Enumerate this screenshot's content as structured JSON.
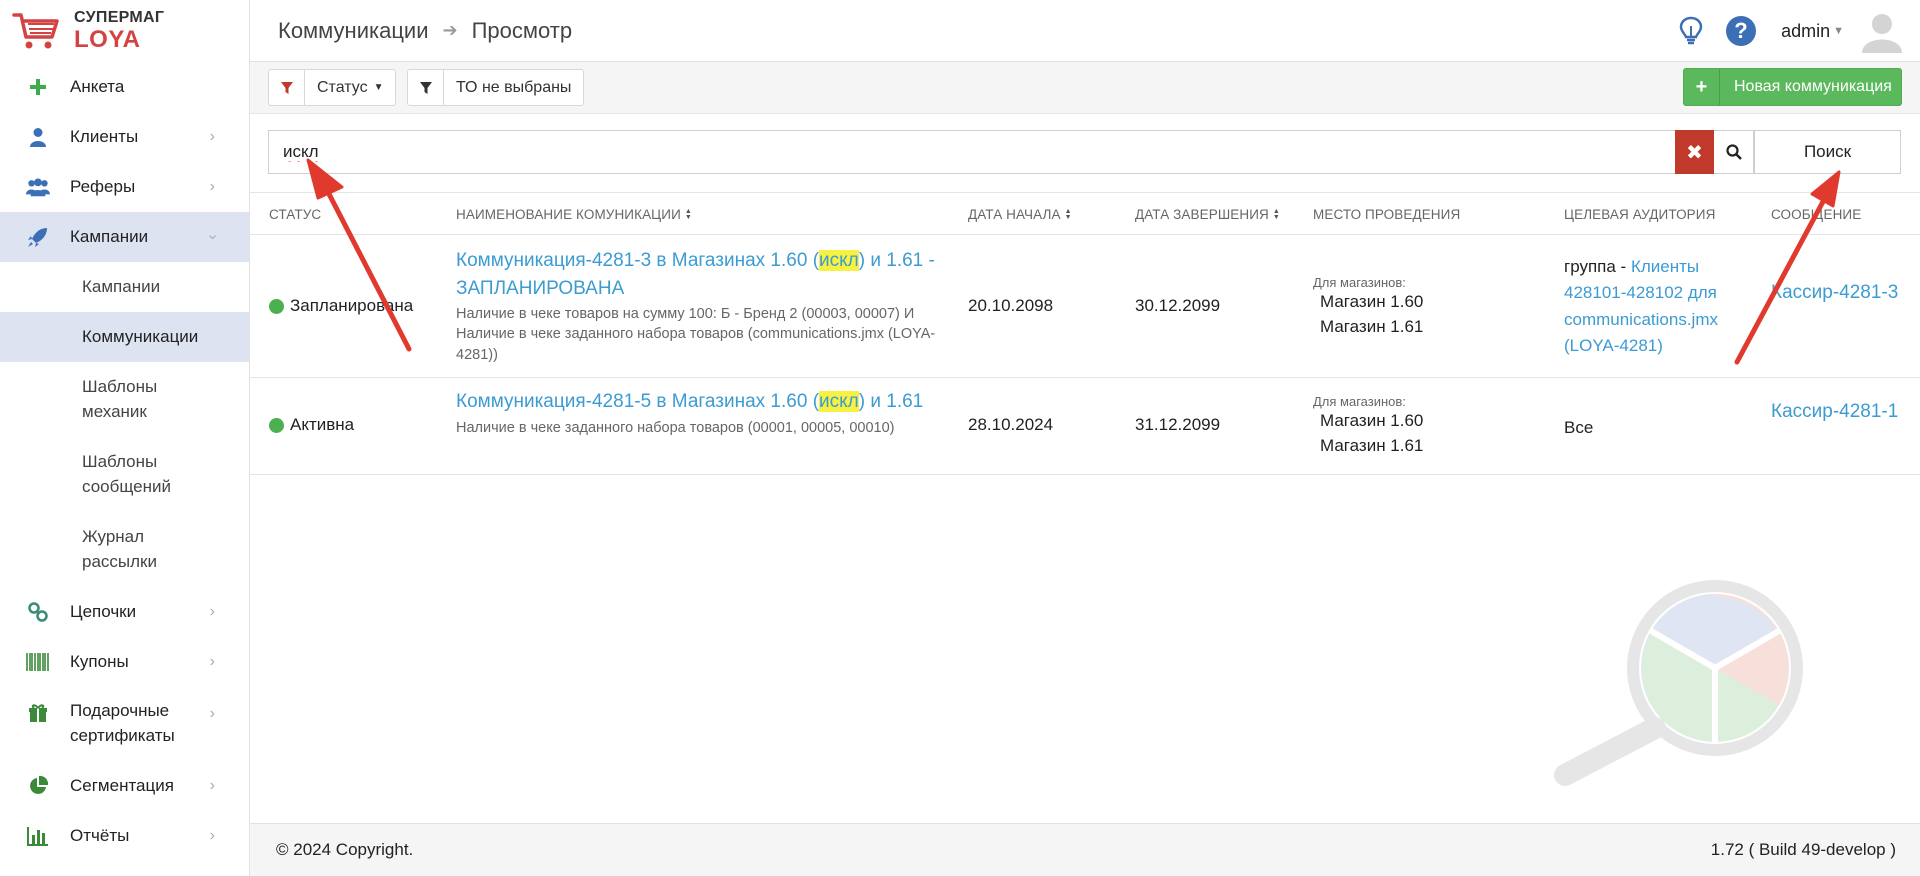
{
  "brand": {
    "line1": "СУПЕРМАГ",
    "line2": "LOYA"
  },
  "header": {
    "breadcrumb": [
      "Коммуникации",
      "Просмотр"
    ],
    "user": "admin"
  },
  "sidebar": {
    "items": [
      {
        "label": "Анкета",
        "icon": "plus-icon"
      },
      {
        "label": "Клиенты",
        "icon": "person-icon"
      },
      {
        "label": "Реферы",
        "icon": "people-icon"
      },
      {
        "label": "Кампании",
        "icon": "rocket-icon"
      },
      {
        "label": "Цепочки",
        "icon": "chain-icon"
      },
      {
        "label": "Купоны",
        "icon": "barcode-icon"
      },
      {
        "label": "Подарочные сертификаты",
        "icon": "gift-icon"
      },
      {
        "label": "Сегментация",
        "icon": "pie-icon"
      },
      {
        "label": "Отчёты",
        "icon": "bar-chart-icon"
      }
    ],
    "subitems": [
      {
        "label": "Кампании"
      },
      {
        "label": "Коммуникации"
      },
      {
        "label": "Шаблоны механик"
      },
      {
        "label": "Шаблоны сообщений"
      },
      {
        "label": "Журнал рассылки"
      }
    ]
  },
  "toolbar": {
    "status_filter": "Статус",
    "to_filter": "ТО не выбраны",
    "new_button": "Новая коммуникация"
  },
  "search": {
    "value": "искл",
    "button": "Поиск"
  },
  "table": {
    "headers": {
      "status": "СТАТУС",
      "name": "НАИМЕНОВАНИЕ КОМУНИКАЦИИ",
      "start": "ДАТА НАЧАЛА",
      "end": "ДАТА ЗАВЕРШЕНИЯ",
      "place": "МЕСТО ПРОВЕДЕНИЯ",
      "audience": "ЦЕЛЕВАЯ АУДИТОРИЯ",
      "message": "СООБЩЕНИЕ"
    },
    "rows": [
      {
        "status": "Запланирована",
        "name_pre": "Коммуникация-4281-3 в Магазинах 1.60 (",
        "name_hl": "искл",
        "name_post": ") и 1.61 - ЗАПЛАНИРОВАНА",
        "desc": "Наличие в чеке товаров на сумму 100: Б - Бренд 2 (00003, 00007) И Наличие в чеке заданного набора товаров (communications.jmx (LOYA-4281))",
        "start": "20.10.2098",
        "end": "30.12.2099",
        "place_caption": "Для магазинов:",
        "places": [
          "Магазин 1.60",
          "Магазин 1.61"
        ],
        "audience_prefix": "группа - ",
        "audience_link": "Клиенты 428101-428102 для communications.jmx (LOYA-4281)",
        "message": "Кассир-4281-3"
      },
      {
        "status": "Активна",
        "name_pre": "Коммуникация-4281-5 в Магазинах 1.60 (",
        "name_hl": "искл",
        "name_post": ") и 1.61",
        "desc": "Наличие в чеке заданного набора товаров (00001, 00005, 00010)",
        "start": "28.10.2024",
        "end": "31.12.2099",
        "place_caption": "Для магазинов:",
        "places": [
          "Магазин 1.60",
          "Магазин 1.61"
        ],
        "audience_text": "Все",
        "message": "Кассир-4281-1"
      }
    ]
  },
  "footer": {
    "copyright": "© 2024 Copyright.",
    "version": "1.72 ( Build 49-develop )"
  },
  "colors": {
    "accent_link": "#3b9bd2",
    "brand_red": "#d34343",
    "status_green": "#4caf50",
    "new_button": "#5cb85c",
    "clear_button": "#c0392b",
    "highlight": "#f7f242",
    "annotation_arrow": "#e03a2f"
  }
}
